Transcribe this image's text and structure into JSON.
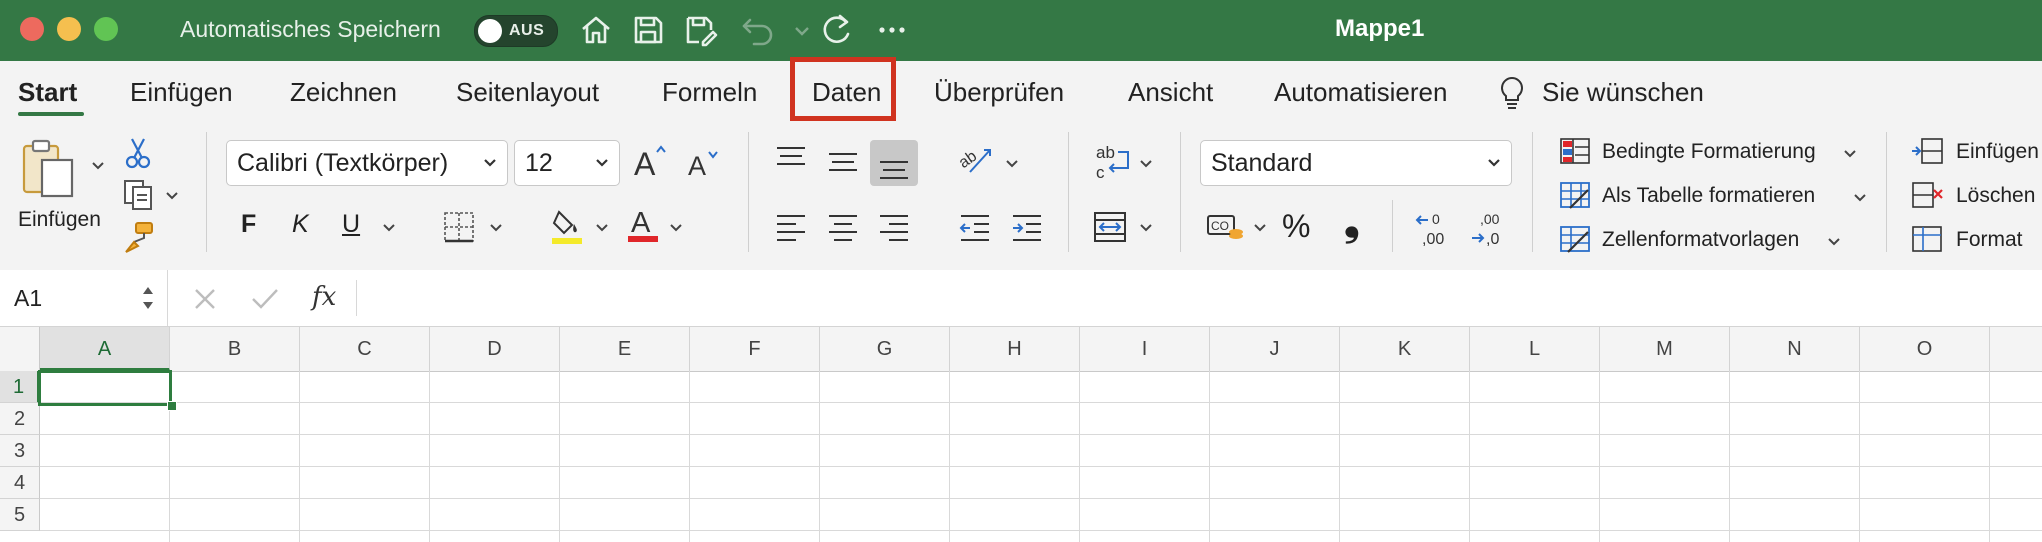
{
  "window": {
    "autosave_label": "Automatisches Speichern",
    "autosave_toggle": "AUS",
    "title": "Mappe1"
  },
  "tabs": [
    {
      "label": "Start",
      "active": true
    },
    {
      "label": "Einfügen"
    },
    {
      "label": "Zeichnen"
    },
    {
      "label": "Seitenlayout"
    },
    {
      "label": "Formeln"
    },
    {
      "label": "Daten",
      "highlighted": true
    },
    {
      "label": "Überprüfen"
    },
    {
      "label": "Ansicht"
    },
    {
      "label": "Automatisieren"
    },
    {
      "label": "Sie wünschen"
    }
  ],
  "ribbon": {
    "paste_label": "Einfügen",
    "font_name": "Calibri (Textkörper)",
    "font_size": "12",
    "bold": "F",
    "italic": "K",
    "underline": "U",
    "number_format": "Standard",
    "percent": "%",
    "comma": "❟",
    "styles": {
      "conditional": "Bedingte Formatierung",
      "as_table": "Als Tabelle formatieren",
      "cell_styles": "Zellenformatvorlagen"
    },
    "cells": {
      "insert": "Einfügen",
      "delete": "Löschen",
      "format": "Format"
    },
    "dec_increase": ",00",
    "dec_decrease": ",0"
  },
  "formula_bar": {
    "name_box": "A1",
    "fx": "fx"
  },
  "grid": {
    "columns": [
      "A",
      "B",
      "C",
      "D",
      "E",
      "F",
      "G",
      "H",
      "I",
      "J",
      "K",
      "L",
      "M",
      "N",
      "O"
    ],
    "rows": [
      "1",
      "2",
      "3",
      "4",
      "5"
    ],
    "selected_cell": "A1"
  },
  "colors": {
    "titlebar": "#347845",
    "highlight": "#d0331f",
    "accent": "#2e7d3f"
  }
}
